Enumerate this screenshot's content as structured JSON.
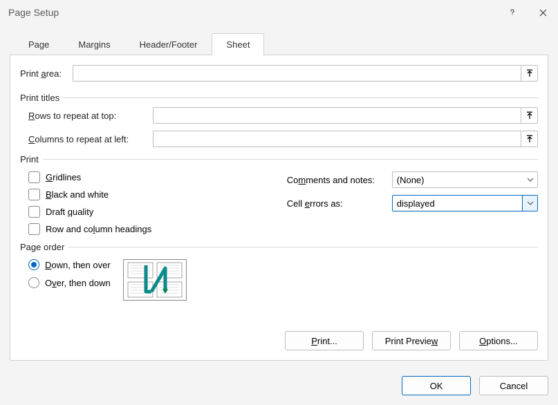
{
  "title": "Page Setup",
  "tabs": {
    "page": "Page",
    "margins": "Margins",
    "headerfooter": "Header/Footer",
    "sheet": "Sheet"
  },
  "printArea": {
    "label": "Print area:",
    "value": ""
  },
  "printTitles": {
    "groupLabel": "Print titles",
    "rowsLabel": "Rows to repeat at top:",
    "rowsValue": "",
    "colsLabel": "Columns to repeat at left:",
    "colsValue": ""
  },
  "print": {
    "groupLabel": "Print",
    "gridlines": "Gridlines",
    "bw": "Black and white",
    "draft": "Draft quality",
    "rch": "Row and column headings",
    "commentsLabel": "Comments and notes:",
    "commentsValue": "(None)",
    "errorsLabel": "Cell errors as:",
    "errorsValue": "displayed"
  },
  "pageOrder": {
    "groupLabel": "Page order",
    "downOver": "Down, then over",
    "overDown": "Over, then down"
  },
  "buttons": {
    "print": "Print...",
    "preview": "Print Preview",
    "options": "Options...",
    "ok": "OK",
    "cancel": "Cancel"
  }
}
